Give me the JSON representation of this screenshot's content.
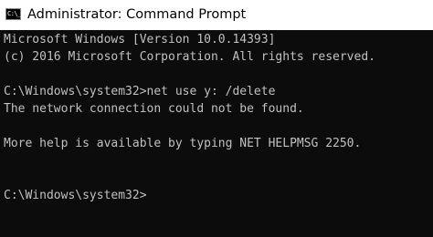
{
  "window": {
    "title": "Administrator: Command Prompt",
    "icon": "cmd-console-icon",
    "icon_glyph": "C:\\_"
  },
  "colors": {
    "console_background": "#0c0c0c",
    "console_text": "#c0c0c0",
    "titlebar_background": "#ffffff"
  },
  "console": {
    "lines": [
      "Microsoft Windows [Version 10.0.14393]",
      "(c) 2016 Microsoft Corporation. All rights reserved.",
      "",
      "C:\\Windows\\system32>net use y: /delete",
      "The network connection could not be found.",
      "",
      "More help is available by typing NET HELPMSG 2250.",
      "",
      "",
      "C:\\Windows\\system32>"
    ]
  }
}
